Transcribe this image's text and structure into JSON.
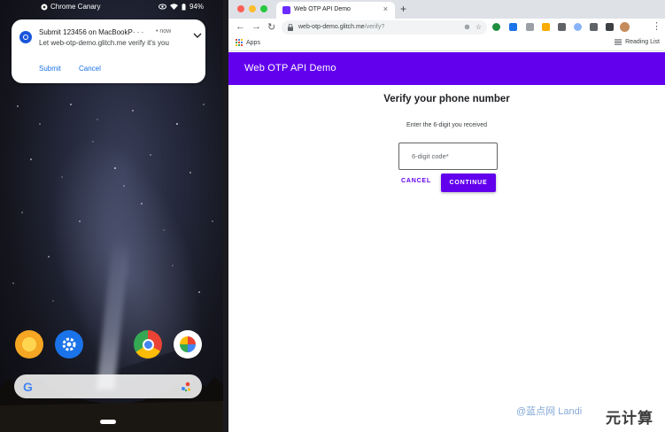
{
  "phone": {
    "status": {
      "app": "Chrome Canary",
      "battery": "94%"
    },
    "notification": {
      "title": "Submit 123456 on MacBookP· · ·",
      "time": "• now",
      "body": "Let web-otp-demo.glitch.me verify it's you",
      "actions": {
        "submit": "Submit",
        "cancel": "Cancel"
      }
    },
    "dock_icons": [
      "app-icon",
      "settings-icon",
      "chrome-icon",
      "photos-icon"
    ],
    "search": {
      "logo": "G"
    }
  },
  "browser": {
    "tab": {
      "title": "Web OTP API Demo"
    },
    "url": {
      "host": "web-otp-demo.glitch.me",
      "path": "/verify?"
    },
    "bookmarks": {
      "apps": "Apps",
      "reading_list": "Reading List"
    }
  },
  "page": {
    "appbar_title": "Web OTP API Demo",
    "heading": "Verify your phone number",
    "instruction": "Enter the 6-digit you received",
    "code_placeholder": "6-digit code*",
    "cancel_label": "CANCEL",
    "continue_label": "CONTINUE"
  },
  "watermark": {
    "text": "@蓝点网 Landi",
    "brand": "元计算"
  },
  "colors": {
    "primary": "#6200ee",
    "notification_link": "#1a73e8"
  }
}
